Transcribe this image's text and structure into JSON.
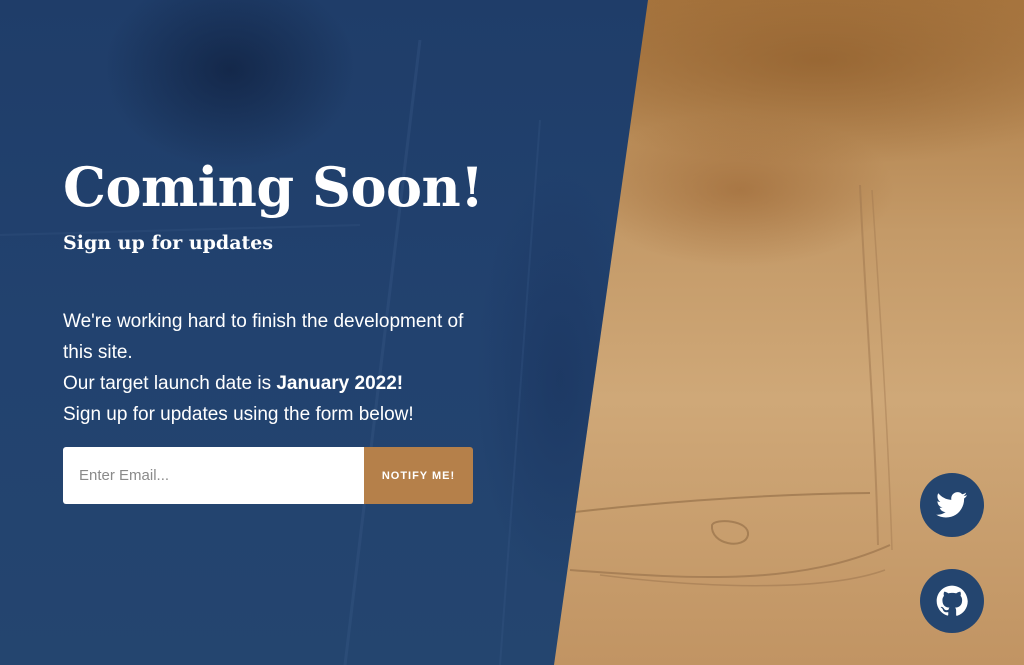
{
  "hero": {
    "title": "Coming Soon!",
    "subtitle": "Sign up for updates",
    "line1": "We're working hard to finish the development of this site.",
    "line2_prefix": "Our target launch date is ",
    "line2_date": "January 2022!",
    "line3": "Sign up for updates using the form below!"
  },
  "form": {
    "email_placeholder": "Enter Email...",
    "email_value": "",
    "button_label": "NOTIFY ME!"
  },
  "social": {
    "items": [
      {
        "icon": "twitter-icon"
      },
      {
        "icon": "github-icon"
      }
    ]
  },
  "colors": {
    "panel_blue": "#22426f",
    "accent": "#b5804a",
    "background_warm": "#c49a68",
    "text": "#ffffff"
  }
}
